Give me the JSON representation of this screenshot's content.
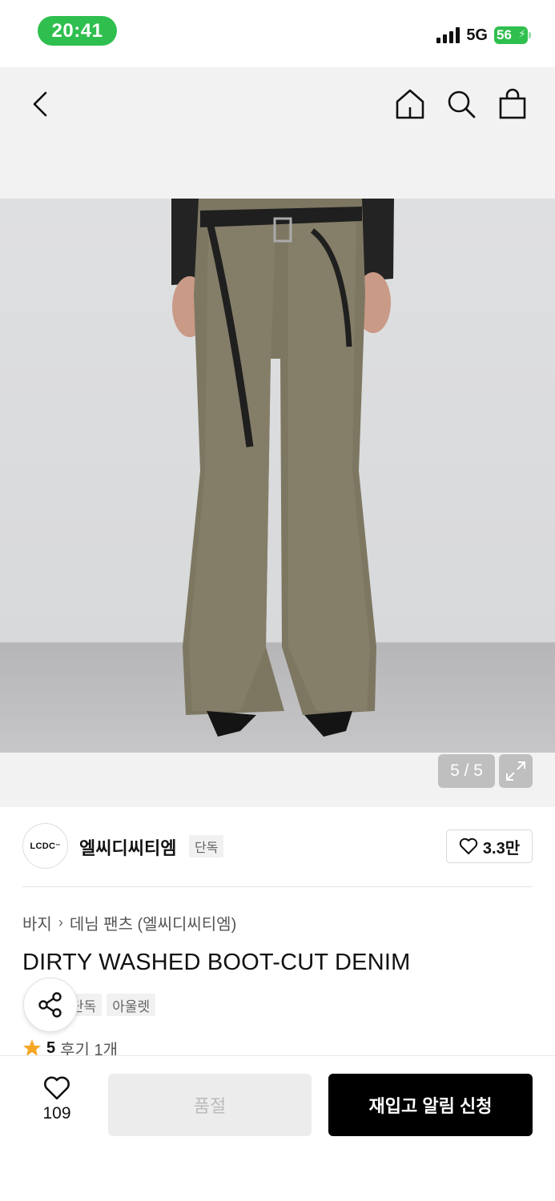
{
  "status_bar": {
    "time": "20:41",
    "network": "5G",
    "battery": "56"
  },
  "gallery": {
    "counter": "5 / 5"
  },
  "brand": {
    "logo_text": "LCDC",
    "logo_mark": "™",
    "name": "엘씨디씨티엠",
    "badge": "단독",
    "likes": "3.3만"
  },
  "product": {
    "breadcrumb": [
      "바지",
      "데님 팬츠 (엘씨디씨티엠)"
    ],
    "title": "DIRTY WASHED BOOT-CUT DENIM",
    "tags": [
      "단독",
      "아울렛"
    ],
    "rating": "5",
    "reviews": "후기 1개"
  },
  "bottom_bar": {
    "wish_count": "109",
    "soldout_label": "품절",
    "restock_label": "재입고 알림 신청"
  },
  "colors": {
    "status_green": "#2fbf4f",
    "primary_button": "#000000",
    "star": "#f5a623"
  },
  "icons": [
    "back-icon",
    "home-icon",
    "search-icon",
    "bag-icon",
    "expand-icon",
    "heart-icon",
    "share-icon",
    "star-icon",
    "chevron-right-icon"
  ]
}
